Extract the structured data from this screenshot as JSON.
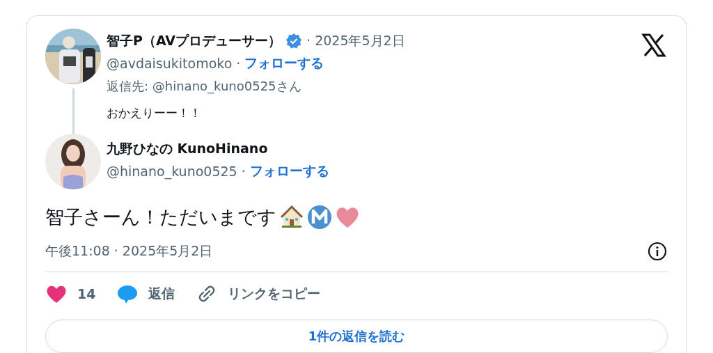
{
  "reply_context": {
    "author": {
      "name": "智子P（AVプロデューサー）",
      "verified": true,
      "date": "· 2025年5月2日",
      "handle": "@avdaisukitomoko",
      "separator": "·",
      "follow": "フォローする"
    },
    "reply_to": "返信先: @hinano_kuno0525さん",
    "text": "おかえりーー！！"
  },
  "tweet": {
    "author": {
      "name": "九野ひなの KunoHinano",
      "handle": "@hinano_kuno0525",
      "separator": "·",
      "follow": "フォローする"
    },
    "text": "智子さーん！ただいまです",
    "timestamp": "午後11:08 · 2025年5月2日"
  },
  "actions": [
    {
      "kind": "like",
      "label": "14"
    },
    {
      "kind": "reply",
      "label": "返信"
    },
    {
      "kind": "link",
      "label": "リンクをコピー"
    }
  ],
  "read_replies": "1件の返信を読む"
}
